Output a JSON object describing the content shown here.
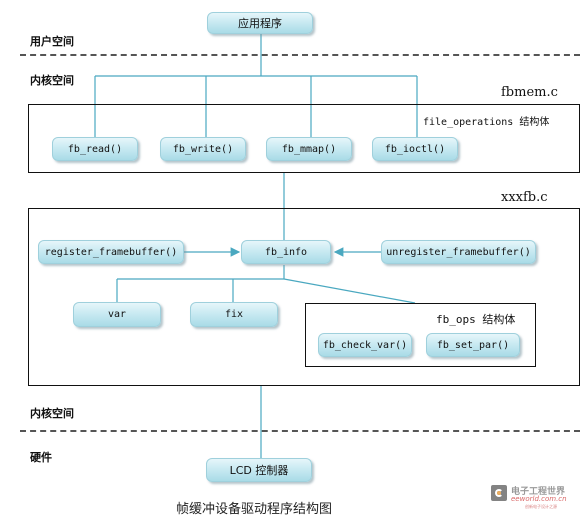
{
  "title": "帧缓冲设备驱动程序结构图",
  "sections": {
    "user_space": "用户空间",
    "kernel_space_top": "内核空间",
    "kernel_space_bottom": "内核空间",
    "hardware": "硬件"
  },
  "files": {
    "fbmem": "fbmem.c",
    "xxxfb": "xxxfb.c"
  },
  "structs": {
    "file_operations": "file_operations 结构体",
    "fb_ops": "fb_ops 结构体"
  },
  "nodes": {
    "app": "应用程序",
    "fb_read": "fb_read()",
    "fb_write": "fb_write()",
    "fb_mmap": "fb_mmap()",
    "fb_ioctl": "fb_ioctl()",
    "register_framebuffer": "register_framebuffer()",
    "fb_info": "fb_info",
    "unregister_framebuffer": "unregister_framebuffer()",
    "var": "var",
    "fix": "fix",
    "fb_check_var": "fb_check_var()",
    "fb_set_par": "fb_set_par()",
    "lcd": "LCD 控制器"
  },
  "watermark": {
    "brand": "电子工程世界",
    "domain": "eeworld.com.cn",
    "tagline": "创新电子设计之源"
  },
  "colors": {
    "connector": "#4aa8c0",
    "node_fill": "#c9eaf2",
    "frame": "#111111"
  }
}
